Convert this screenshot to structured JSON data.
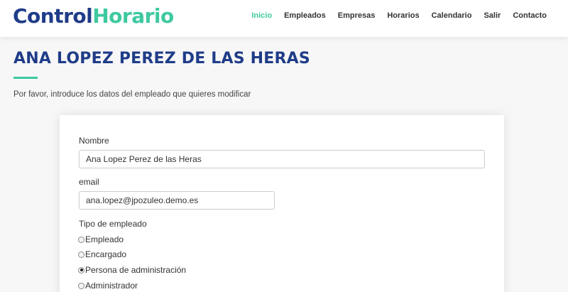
{
  "brand": {
    "part1": "Control",
    "part2": "Horario"
  },
  "nav": [
    {
      "label": "Inicio",
      "active": true
    },
    {
      "label": "Empleados"
    },
    {
      "label": "Empresas"
    },
    {
      "label": "Horarios"
    },
    {
      "label": "Calendario"
    },
    {
      "label": "Salir"
    },
    {
      "label": "Contacto"
    }
  ],
  "page": {
    "title": "ANA LOPEZ PEREZ DE LAS HERAS",
    "intro": "Por favor, introduce los datos del empleado que quieres modificar"
  },
  "form": {
    "name_label": "Nombre",
    "name_value": "Ana Lopez Perez de las Heras",
    "email_label": "email",
    "email_value": "ana.lopez@jpozuleo.demo.es",
    "type_label": "Tipo de empleado",
    "types": [
      {
        "label": "Empleado",
        "checked": false
      },
      {
        "label": "Encargado",
        "checked": false
      },
      {
        "label": "Persona de administración",
        "checked": true
      },
      {
        "label": "Administrador",
        "checked": false
      }
    ]
  },
  "colors": {
    "brand_blue": "#1f3c88",
    "accent_green": "#3ec9a0"
  }
}
